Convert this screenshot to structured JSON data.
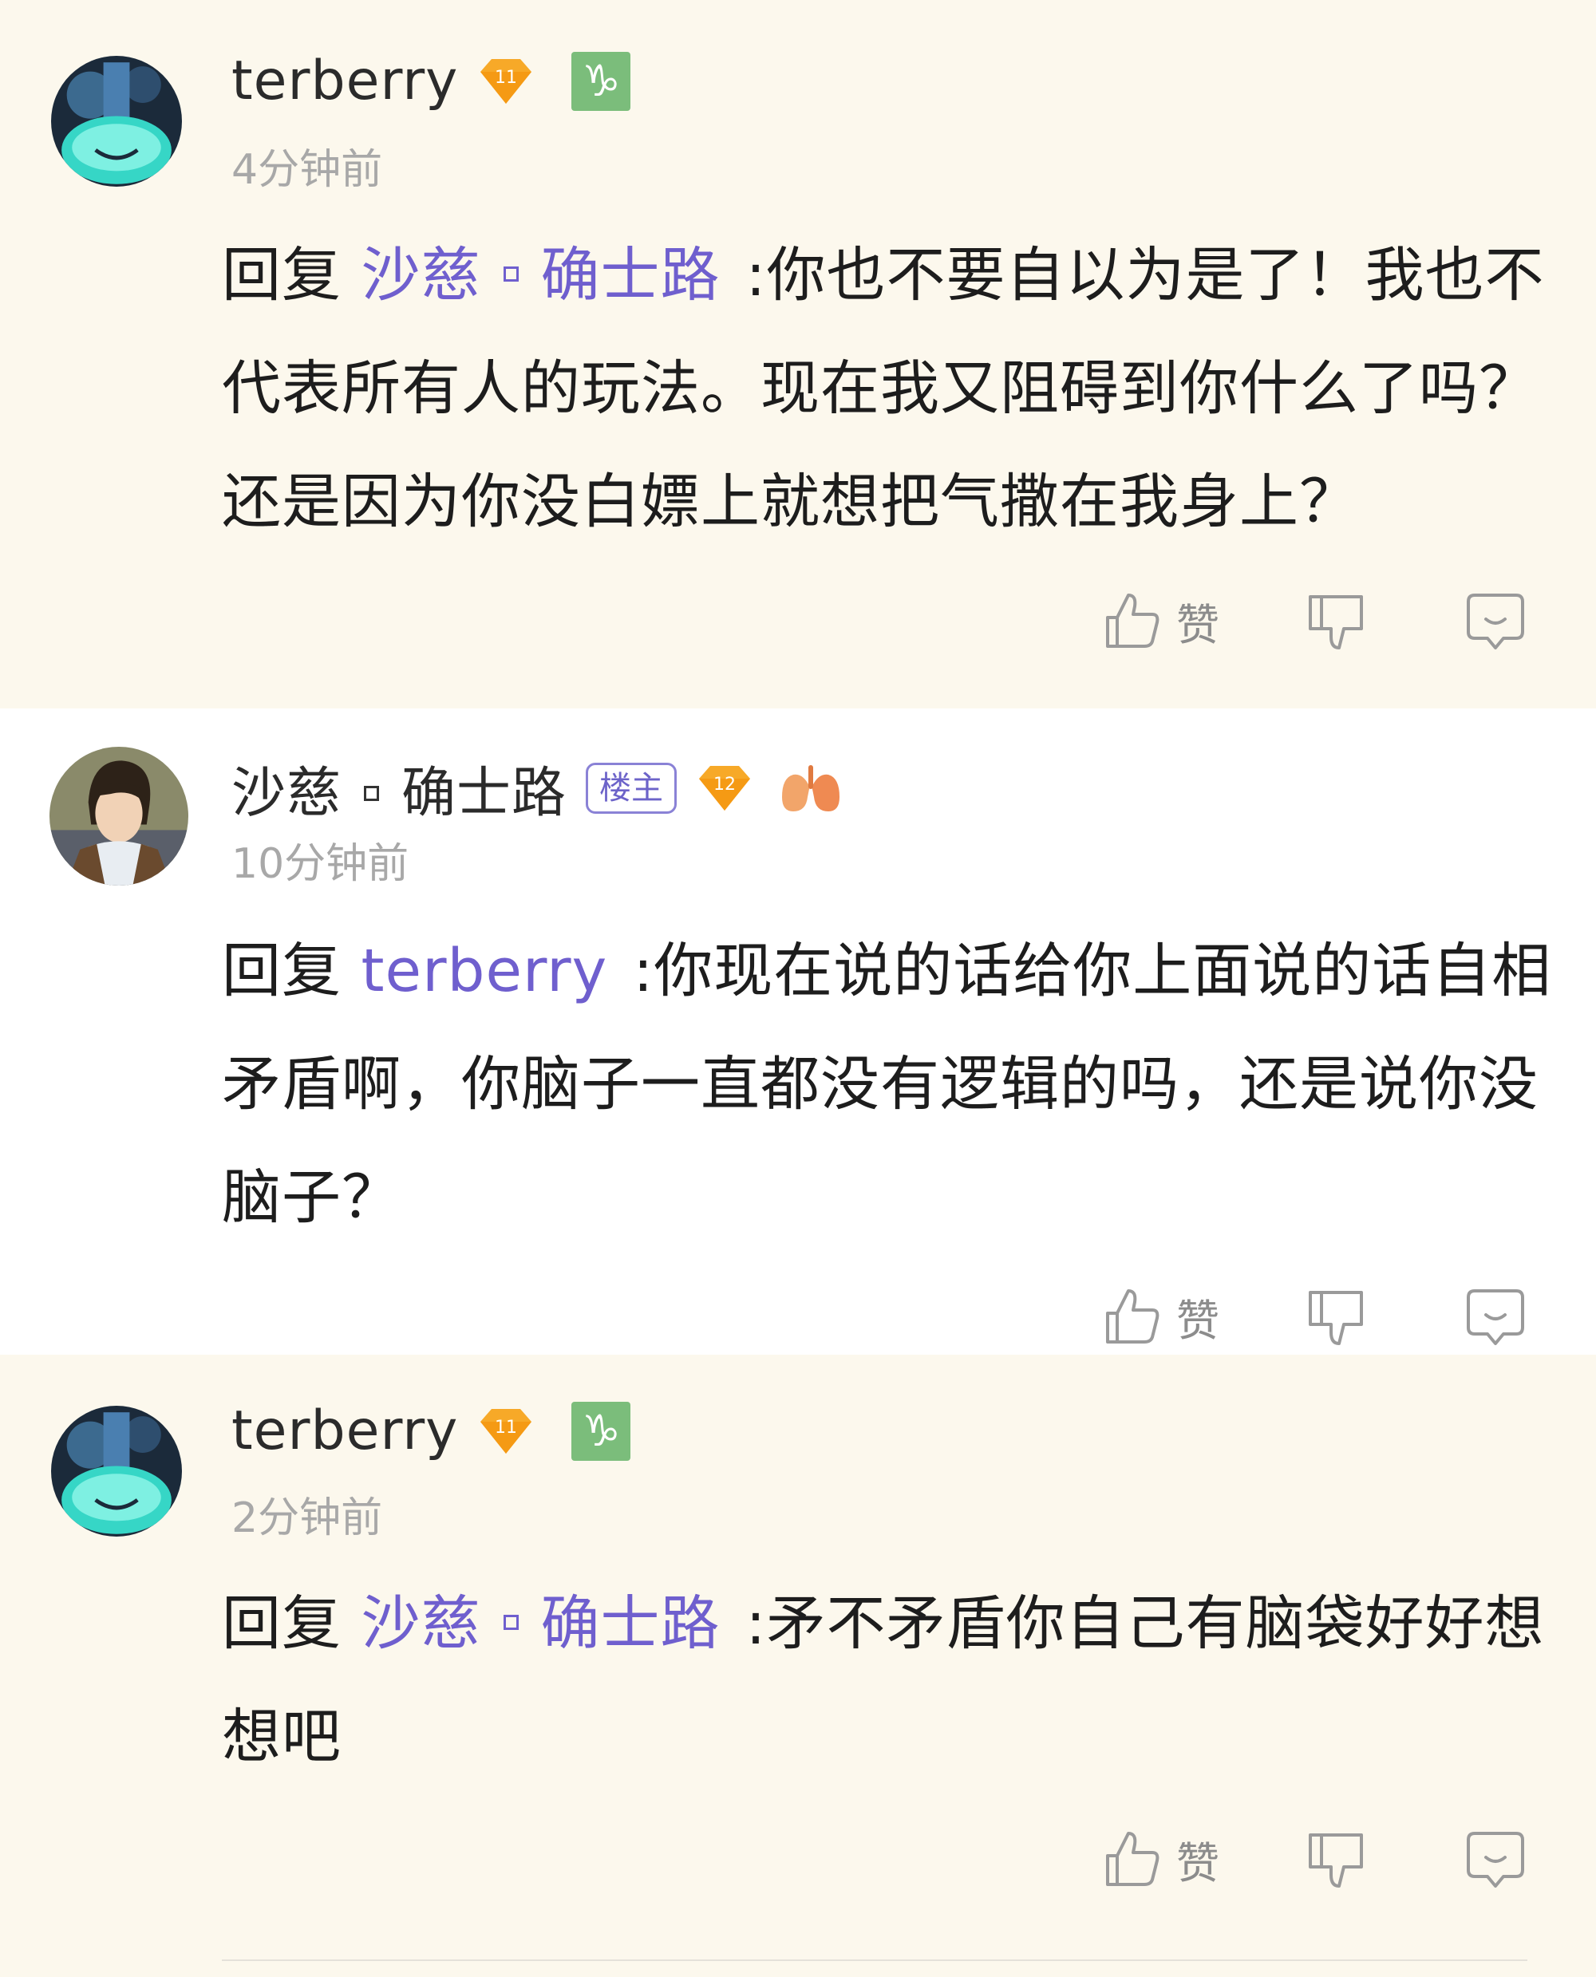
{
  "comments": [
    {
      "user": "terberry",
      "level": "11",
      "zodiac_icon": "capricorn-icon",
      "time": "4分钟前",
      "reply_prefix": "回复",
      "mention_a": "沙慈",
      "mention_b": "确士路",
      "text": ":你也不要自以为是了！我也不代表所有人的玩法。现在我又阻碍到你什么了吗？还是因为你没白嫖上就想把气撒在我身上？",
      "like_label": "赞"
    },
    {
      "user_a": "沙慈",
      "user_b": "确士路",
      "op_badge": "楼主",
      "level": "12",
      "time": "10分钟前",
      "reply_prefix": "回复",
      "mention": "terberry",
      "text": ":你现在说的话给你上面说的话自相矛盾啊，你脑子一直都没有逻辑的吗，还是说你没脑子？",
      "like_label": "赞"
    },
    {
      "user": "terberry",
      "level": "11",
      "zodiac_icon": "capricorn-icon",
      "time": "2分钟前",
      "reply_prefix": "回复",
      "mention_a": "沙慈",
      "mention_b": "确士路",
      "text": ":矛不矛盾你自己有脑袋好好想想吧",
      "like_label": "赞"
    }
  ],
  "colors": {
    "mention": "#6f5fce",
    "time": "#a8a8a8",
    "level_badge": "#f7a928",
    "zodiac_bg": "#7bbd7b",
    "op_badge": "#6c63c9"
  }
}
